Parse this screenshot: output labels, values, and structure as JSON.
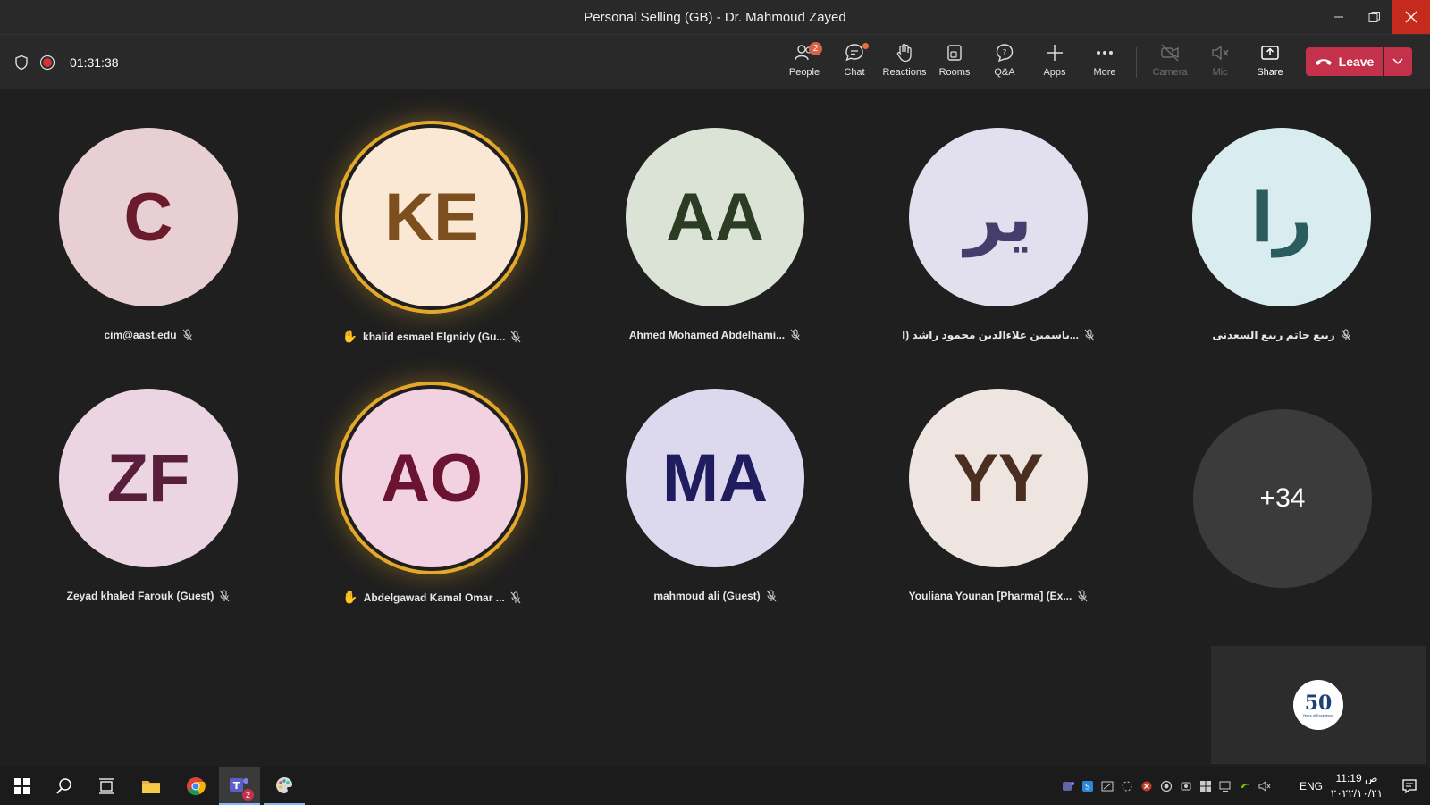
{
  "window": {
    "title": "Personal Selling (GB) - Dr. Mahmoud Zayed"
  },
  "meeting": {
    "timer": "01:31:38"
  },
  "toolbar": {
    "people": {
      "label": "People",
      "badge": "2"
    },
    "chat": {
      "label": "Chat"
    },
    "reactions": {
      "label": "Reactions"
    },
    "rooms": {
      "label": "Rooms"
    },
    "qa": {
      "label": "Q&A"
    },
    "apps": {
      "label": "Apps"
    },
    "more": {
      "label": "More"
    },
    "camera": {
      "label": "Camera"
    },
    "mic": {
      "label": "Mic"
    },
    "share": {
      "label": "Share"
    },
    "leave": {
      "label": "Leave"
    }
  },
  "participants": [
    {
      "initials": "C",
      "name": "cim@aast.edu",
      "bg": "#e8cfd3",
      "fg": "#6b1c2c",
      "hand": false,
      "speaking": false
    },
    {
      "initials": "KE",
      "name": "khalid esmael Elgnidy (Gu...",
      "bg": "#fbe8d4",
      "fg": "#7d4f1e",
      "hand": true,
      "speaking": true
    },
    {
      "initials": "AA",
      "name": "Ahmed Mohamed Abdelhami...",
      "bg": "#dbe3d7",
      "fg": "#2b3b24",
      "hand": false,
      "speaking": false
    },
    {
      "initials": "ير",
      "name": "ياسمين علاءالدين محمود راشد (ا...",
      "bg": "#e2dfee",
      "fg": "#463d6d",
      "hand": false,
      "speaking": false
    },
    {
      "initials": "را",
      "name": "ربيع حاتم ربيع السعدنى",
      "bg": "#d9ecef",
      "fg": "#2b5d5e",
      "hand": false,
      "speaking": false
    },
    {
      "initials": "ZF",
      "name": "Zeyad khaled Farouk (Guest)",
      "bg": "#ecd5e3",
      "fg": "#5a1e3d",
      "hand": false,
      "speaking": false
    },
    {
      "initials": "AO",
      "name": "Abdelgawad Kamal Omar ...",
      "bg": "#f2d2e0",
      "fg": "#6b1432",
      "hand": true,
      "speaking": true
    },
    {
      "initials": "MA",
      "name": "mahmoud ali (Guest)",
      "bg": "#dcd8ee",
      "fg": "#1f1d5e",
      "hand": false,
      "speaking": false
    },
    {
      "initials": "YY",
      "name": "Youliana Younan [Pharma] (Ex...",
      "bg": "#eee5e0",
      "fg": "#4a2e22",
      "hand": false,
      "speaking": false
    }
  ],
  "overflow": {
    "label": "+34"
  },
  "self_view": {
    "logo_text": "50",
    "logo_sub": "Years of Excellence"
  },
  "taskbar": {
    "teams_badge": "2",
    "lang": "ENG",
    "time": "11:19 ص",
    "date": "٢٠٢٢/١٠/٢١"
  }
}
